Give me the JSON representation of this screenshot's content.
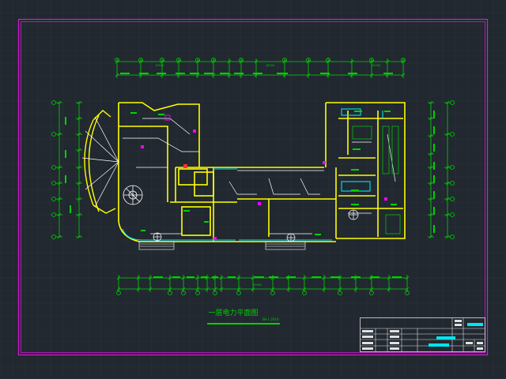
{
  "colors": {
    "background": "#212830",
    "grid": "#2c353e",
    "frame": "#d21ad2",
    "inner_frame": "#e0e0e0",
    "wall": "#ffff00",
    "dimension": "#00d200",
    "power_line": "#ffffff",
    "accent_cyan": "#00e5ee",
    "accent_magenta": "#ff00ff",
    "accent_red": "#ff3030"
  },
  "drawing": {
    "title": "一层电力平面图",
    "scale": "SH-1 2010"
  },
  "title_block": {
    "highlight_labels": [
      "",
      "",
      ""
    ]
  }
}
